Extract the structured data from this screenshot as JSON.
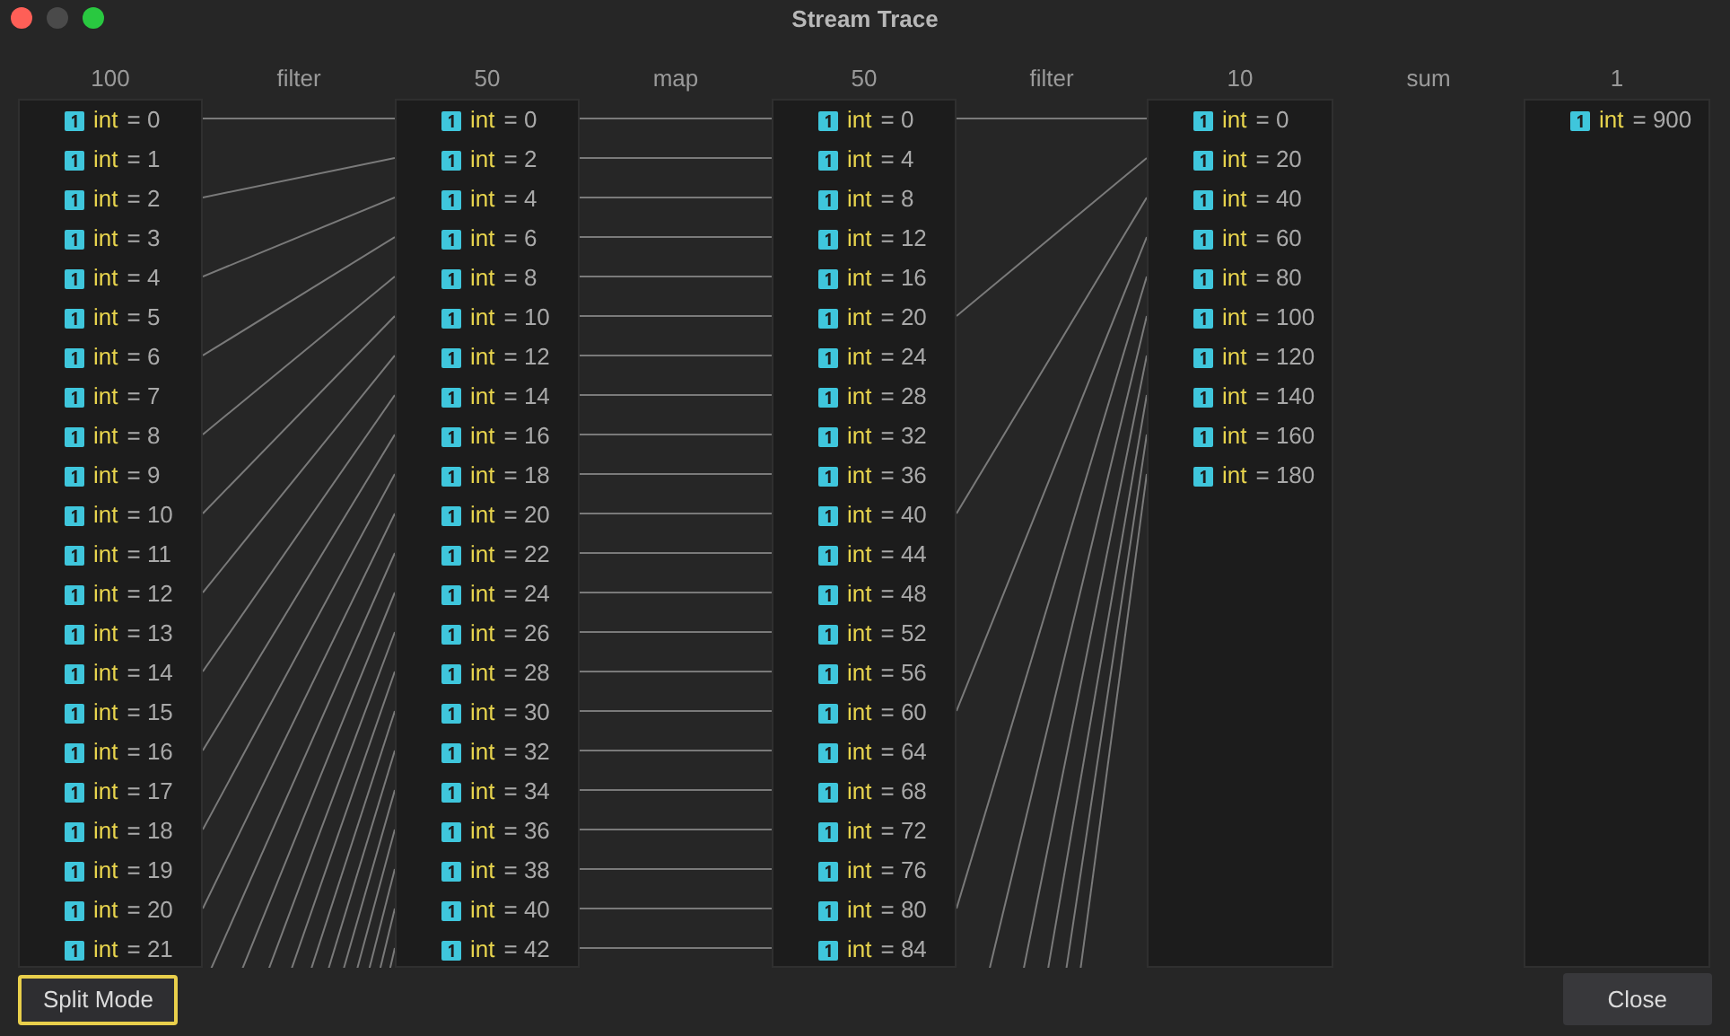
{
  "window": {
    "title": "Stream Trace"
  },
  "streams": [
    {
      "count": "100",
      "items": [
        {
          "name": "int",
          "value": "= 0"
        },
        {
          "name": "int",
          "value": "= 1"
        },
        {
          "name": "int",
          "value": "= 2"
        },
        {
          "name": "int",
          "value": "= 3"
        },
        {
          "name": "int",
          "value": "= 4"
        },
        {
          "name": "int",
          "value": "= 5"
        },
        {
          "name": "int",
          "value": "= 6"
        },
        {
          "name": "int",
          "value": "= 7"
        },
        {
          "name": "int",
          "value": "= 8"
        },
        {
          "name": "int",
          "value": "= 9"
        },
        {
          "name": "int",
          "value": "= 10"
        },
        {
          "name": "int",
          "value": "= 11"
        },
        {
          "name": "int",
          "value": "= 12"
        },
        {
          "name": "int",
          "value": "= 13"
        },
        {
          "name": "int",
          "value": "= 14"
        },
        {
          "name": "int",
          "value": "= 15"
        },
        {
          "name": "int",
          "value": "= 16"
        },
        {
          "name": "int",
          "value": "= 17"
        },
        {
          "name": "int",
          "value": "= 18"
        },
        {
          "name": "int",
          "value": "= 19"
        },
        {
          "name": "int",
          "value": "= 20"
        },
        {
          "name": "int",
          "value": "= 21"
        }
      ]
    },
    {
      "count": "50",
      "items": [
        {
          "name": "int",
          "value": "= 0"
        },
        {
          "name": "int",
          "value": "= 2"
        },
        {
          "name": "int",
          "value": "= 4"
        },
        {
          "name": "int",
          "value": "= 6"
        },
        {
          "name": "int",
          "value": "= 8"
        },
        {
          "name": "int",
          "value": "= 10"
        },
        {
          "name": "int",
          "value": "= 12"
        },
        {
          "name": "int",
          "value": "= 14"
        },
        {
          "name": "int",
          "value": "= 16"
        },
        {
          "name": "int",
          "value": "= 18"
        },
        {
          "name": "int",
          "value": "= 20"
        },
        {
          "name": "int",
          "value": "= 22"
        },
        {
          "name": "int",
          "value": "= 24"
        },
        {
          "name": "int",
          "value": "= 26"
        },
        {
          "name": "int",
          "value": "= 28"
        },
        {
          "name": "int",
          "value": "= 30"
        },
        {
          "name": "int",
          "value": "= 32"
        },
        {
          "name": "int",
          "value": "= 34"
        },
        {
          "name": "int",
          "value": "= 36"
        },
        {
          "name": "int",
          "value": "= 38"
        },
        {
          "name": "int",
          "value": "= 40"
        },
        {
          "name": "int",
          "value": "= 42"
        }
      ]
    },
    {
      "count": "50",
      "items": [
        {
          "name": "int",
          "value": "= 0"
        },
        {
          "name": "int",
          "value": "= 4"
        },
        {
          "name": "int",
          "value": "= 8"
        },
        {
          "name": "int",
          "value": "= 12"
        },
        {
          "name": "int",
          "value": "= 16"
        },
        {
          "name": "int",
          "value": "= 20"
        },
        {
          "name": "int",
          "value": "= 24"
        },
        {
          "name": "int",
          "value": "= 28"
        },
        {
          "name": "int",
          "value": "= 32"
        },
        {
          "name": "int",
          "value": "= 36"
        },
        {
          "name": "int",
          "value": "= 40"
        },
        {
          "name": "int",
          "value": "= 44"
        },
        {
          "name": "int",
          "value": "= 48"
        },
        {
          "name": "int",
          "value": "= 52"
        },
        {
          "name": "int",
          "value": "= 56"
        },
        {
          "name": "int",
          "value": "= 60"
        },
        {
          "name": "int",
          "value": "= 64"
        },
        {
          "name": "int",
          "value": "= 68"
        },
        {
          "name": "int",
          "value": "= 72"
        },
        {
          "name": "int",
          "value": "= 76"
        },
        {
          "name": "int",
          "value": "= 80"
        },
        {
          "name": "int",
          "value": "= 84"
        }
      ]
    },
    {
      "count": "10",
      "items": [
        {
          "name": "int",
          "value": "= 0"
        },
        {
          "name": "int",
          "value": "= 20"
        },
        {
          "name": "int",
          "value": "= 40"
        },
        {
          "name": "int",
          "value": "= 60"
        },
        {
          "name": "int",
          "value": "= 80"
        },
        {
          "name": "int",
          "value": "= 100"
        },
        {
          "name": "int",
          "value": "= 120"
        },
        {
          "name": "int",
          "value": "= 140"
        },
        {
          "name": "int",
          "value": "= 160"
        },
        {
          "name": "int",
          "value": "= 180"
        }
      ]
    },
    {
      "count": "1",
      "items": [
        {
          "name": "int",
          "value": "= 900"
        }
      ]
    }
  ],
  "operations": [
    {
      "label": "filter",
      "kind": "filter"
    },
    {
      "label": "map",
      "kind": "map"
    },
    {
      "label": "filter",
      "kind": "filter"
    },
    {
      "label": "sum",
      "kind": "reduce"
    }
  ],
  "buttons": [
    {
      "label": "Split Mode",
      "focused": true
    },
    {
      "label": "Close",
      "focused": false
    }
  ]
}
